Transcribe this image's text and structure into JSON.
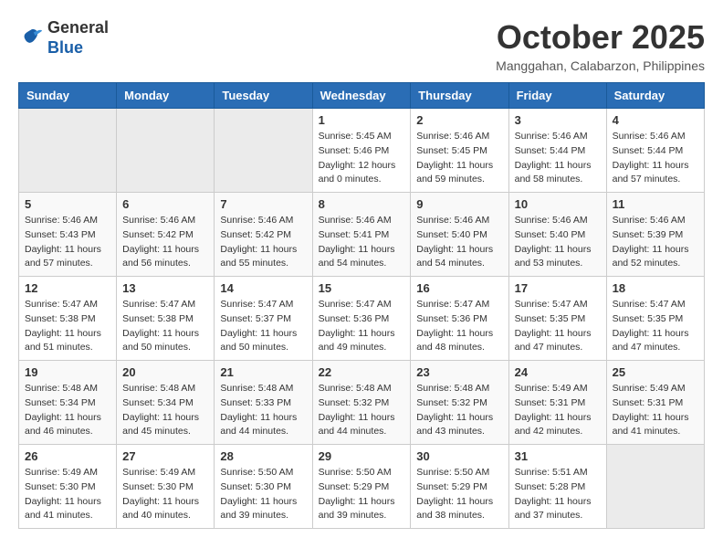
{
  "header": {
    "logo_general": "General",
    "logo_blue": "Blue",
    "month_title": "October 2025",
    "location": "Manggahan, Calabarzon, Philippines"
  },
  "weekdays": [
    "Sunday",
    "Monday",
    "Tuesday",
    "Wednesday",
    "Thursday",
    "Friday",
    "Saturday"
  ],
  "weeks": [
    [
      {
        "day": "",
        "sunrise": "",
        "sunset": "",
        "daylight": ""
      },
      {
        "day": "",
        "sunrise": "",
        "sunset": "",
        "daylight": ""
      },
      {
        "day": "",
        "sunrise": "",
        "sunset": "",
        "daylight": ""
      },
      {
        "day": "1",
        "sunrise": "Sunrise: 5:45 AM",
        "sunset": "Sunset: 5:46 PM",
        "daylight": "Daylight: 12 hours and 0 minutes."
      },
      {
        "day": "2",
        "sunrise": "Sunrise: 5:46 AM",
        "sunset": "Sunset: 5:45 PM",
        "daylight": "Daylight: 11 hours and 59 minutes."
      },
      {
        "day": "3",
        "sunrise": "Sunrise: 5:46 AM",
        "sunset": "Sunset: 5:44 PM",
        "daylight": "Daylight: 11 hours and 58 minutes."
      },
      {
        "day": "4",
        "sunrise": "Sunrise: 5:46 AM",
        "sunset": "Sunset: 5:44 PM",
        "daylight": "Daylight: 11 hours and 57 minutes."
      }
    ],
    [
      {
        "day": "5",
        "sunrise": "Sunrise: 5:46 AM",
        "sunset": "Sunset: 5:43 PM",
        "daylight": "Daylight: 11 hours and 57 minutes."
      },
      {
        "day": "6",
        "sunrise": "Sunrise: 5:46 AM",
        "sunset": "Sunset: 5:42 PM",
        "daylight": "Daylight: 11 hours and 56 minutes."
      },
      {
        "day": "7",
        "sunrise": "Sunrise: 5:46 AM",
        "sunset": "Sunset: 5:42 PM",
        "daylight": "Daylight: 11 hours and 55 minutes."
      },
      {
        "day": "8",
        "sunrise": "Sunrise: 5:46 AM",
        "sunset": "Sunset: 5:41 PM",
        "daylight": "Daylight: 11 hours and 54 minutes."
      },
      {
        "day": "9",
        "sunrise": "Sunrise: 5:46 AM",
        "sunset": "Sunset: 5:40 PM",
        "daylight": "Daylight: 11 hours and 54 minutes."
      },
      {
        "day": "10",
        "sunrise": "Sunrise: 5:46 AM",
        "sunset": "Sunset: 5:40 PM",
        "daylight": "Daylight: 11 hours and 53 minutes."
      },
      {
        "day": "11",
        "sunrise": "Sunrise: 5:46 AM",
        "sunset": "Sunset: 5:39 PM",
        "daylight": "Daylight: 11 hours and 52 minutes."
      }
    ],
    [
      {
        "day": "12",
        "sunrise": "Sunrise: 5:47 AM",
        "sunset": "Sunset: 5:38 PM",
        "daylight": "Daylight: 11 hours and 51 minutes."
      },
      {
        "day": "13",
        "sunrise": "Sunrise: 5:47 AM",
        "sunset": "Sunset: 5:38 PM",
        "daylight": "Daylight: 11 hours and 50 minutes."
      },
      {
        "day": "14",
        "sunrise": "Sunrise: 5:47 AM",
        "sunset": "Sunset: 5:37 PM",
        "daylight": "Daylight: 11 hours and 50 minutes."
      },
      {
        "day": "15",
        "sunrise": "Sunrise: 5:47 AM",
        "sunset": "Sunset: 5:36 PM",
        "daylight": "Daylight: 11 hours and 49 minutes."
      },
      {
        "day": "16",
        "sunrise": "Sunrise: 5:47 AM",
        "sunset": "Sunset: 5:36 PM",
        "daylight": "Daylight: 11 hours and 48 minutes."
      },
      {
        "day": "17",
        "sunrise": "Sunrise: 5:47 AM",
        "sunset": "Sunset: 5:35 PM",
        "daylight": "Daylight: 11 hours and 47 minutes."
      },
      {
        "day": "18",
        "sunrise": "Sunrise: 5:47 AM",
        "sunset": "Sunset: 5:35 PM",
        "daylight": "Daylight: 11 hours and 47 minutes."
      }
    ],
    [
      {
        "day": "19",
        "sunrise": "Sunrise: 5:48 AM",
        "sunset": "Sunset: 5:34 PM",
        "daylight": "Daylight: 11 hours and 46 minutes."
      },
      {
        "day": "20",
        "sunrise": "Sunrise: 5:48 AM",
        "sunset": "Sunset: 5:34 PM",
        "daylight": "Daylight: 11 hours and 45 minutes."
      },
      {
        "day": "21",
        "sunrise": "Sunrise: 5:48 AM",
        "sunset": "Sunset: 5:33 PM",
        "daylight": "Daylight: 11 hours and 44 minutes."
      },
      {
        "day": "22",
        "sunrise": "Sunrise: 5:48 AM",
        "sunset": "Sunset: 5:32 PM",
        "daylight": "Daylight: 11 hours and 44 minutes."
      },
      {
        "day": "23",
        "sunrise": "Sunrise: 5:48 AM",
        "sunset": "Sunset: 5:32 PM",
        "daylight": "Daylight: 11 hours and 43 minutes."
      },
      {
        "day": "24",
        "sunrise": "Sunrise: 5:49 AM",
        "sunset": "Sunset: 5:31 PM",
        "daylight": "Daylight: 11 hours and 42 minutes."
      },
      {
        "day": "25",
        "sunrise": "Sunrise: 5:49 AM",
        "sunset": "Sunset: 5:31 PM",
        "daylight": "Daylight: 11 hours and 41 minutes."
      }
    ],
    [
      {
        "day": "26",
        "sunrise": "Sunrise: 5:49 AM",
        "sunset": "Sunset: 5:30 PM",
        "daylight": "Daylight: 11 hours and 41 minutes."
      },
      {
        "day": "27",
        "sunrise": "Sunrise: 5:49 AM",
        "sunset": "Sunset: 5:30 PM",
        "daylight": "Daylight: 11 hours and 40 minutes."
      },
      {
        "day": "28",
        "sunrise": "Sunrise: 5:50 AM",
        "sunset": "Sunset: 5:30 PM",
        "daylight": "Daylight: 11 hours and 39 minutes."
      },
      {
        "day": "29",
        "sunrise": "Sunrise: 5:50 AM",
        "sunset": "Sunset: 5:29 PM",
        "daylight": "Daylight: 11 hours and 39 minutes."
      },
      {
        "day": "30",
        "sunrise": "Sunrise: 5:50 AM",
        "sunset": "Sunset: 5:29 PM",
        "daylight": "Daylight: 11 hours and 38 minutes."
      },
      {
        "day": "31",
        "sunrise": "Sunrise: 5:51 AM",
        "sunset": "Sunset: 5:28 PM",
        "daylight": "Daylight: 11 hours and 37 minutes."
      },
      {
        "day": "",
        "sunrise": "",
        "sunset": "",
        "daylight": ""
      }
    ]
  ]
}
